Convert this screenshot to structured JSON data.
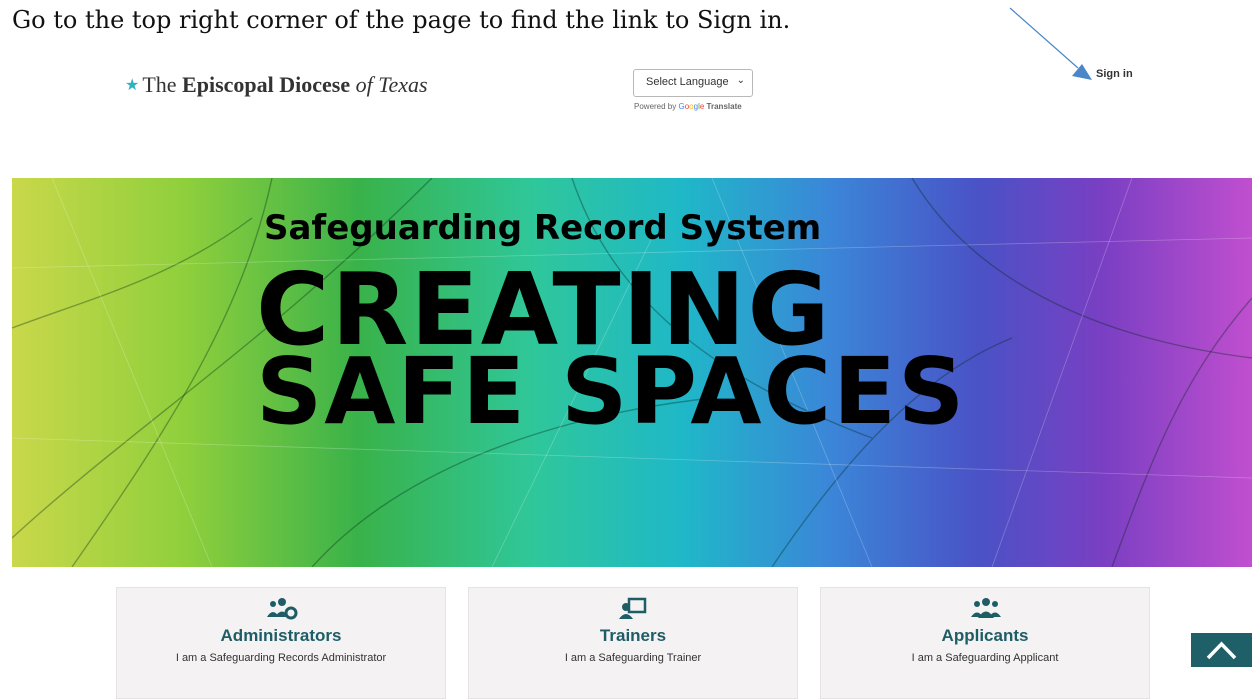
{
  "instruction": "Go to the top right corner of the page to find the link to Sign in.",
  "header": {
    "logo_prefix": "The",
    "logo_bold": "Episcopal Diocese",
    "logo_of": "of",
    "logo_place": "Texas",
    "language_select": "Select Language",
    "powered_by": "Powered by",
    "google_g1": "G",
    "google_g2": "o",
    "google_g3": "o",
    "google_g4": "g",
    "google_g5": "l",
    "google_g6": "e",
    "translate": "Translate",
    "sign_in": "Sign in"
  },
  "hero": {
    "subtitle": "Safeguarding Record System",
    "line1": "CREATING",
    "line2": "SAFE SPACES"
  },
  "cards": [
    {
      "icon": "users-cog-icon",
      "title": "Administrators",
      "desc": "I am a Safeguarding Records Administrator"
    },
    {
      "icon": "chalkboard-teacher-icon",
      "title": "Trainers",
      "desc": "I am a Safeguarding Trainer"
    },
    {
      "icon": "users-icon",
      "title": "Applicants",
      "desc": "I am a Safeguarding Applicant"
    }
  ],
  "colors": {
    "accent": "#1e5d66",
    "to_top_bg": "#1f5f68",
    "arrow": "#4a86c8"
  },
  "icons": {
    "to_top": "chevron-up-icon",
    "annotation": "arrow-pointer-icon"
  }
}
